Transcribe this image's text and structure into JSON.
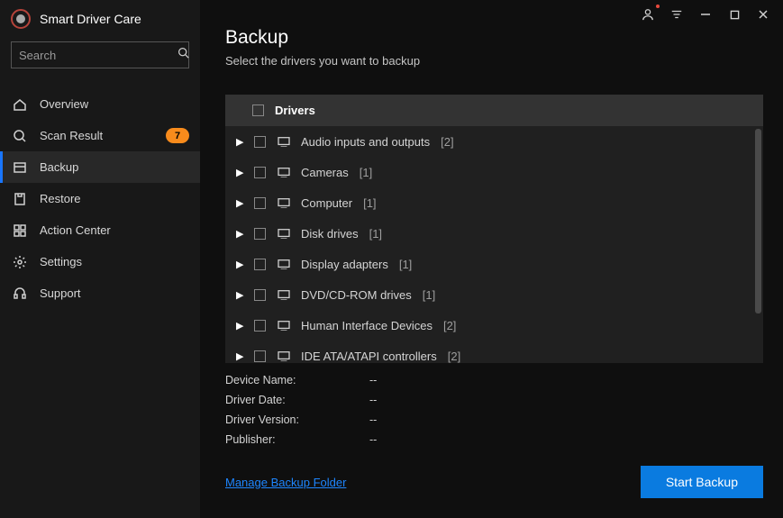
{
  "app": {
    "title": "Smart Driver Care"
  },
  "search": {
    "placeholder": "Search"
  },
  "sidebar": {
    "items": [
      {
        "label": "Overview",
        "badge": null
      },
      {
        "label": "Scan Result",
        "badge": "7"
      },
      {
        "label": "Backup",
        "badge": null
      },
      {
        "label": "Restore",
        "badge": null
      },
      {
        "label": "Action Center",
        "badge": null
      },
      {
        "label": "Settings",
        "badge": null
      },
      {
        "label": "Support",
        "badge": null
      }
    ]
  },
  "page": {
    "title": "Backup",
    "subtitle": "Select the drivers you want to backup",
    "driversHeader": "Drivers",
    "manageLink": "Manage Backup Folder",
    "startButton": "Start Backup"
  },
  "drivers": [
    {
      "name": "Audio inputs and outputs",
      "count": "[2]"
    },
    {
      "name": "Cameras",
      "count": "[1]"
    },
    {
      "name": "Computer",
      "count": "[1]"
    },
    {
      "name": "Disk drives",
      "count": "[1]"
    },
    {
      "name": "Display adapters",
      "count": "[1]"
    },
    {
      "name": "DVD/CD-ROM drives",
      "count": "[1]"
    },
    {
      "name": "Human Interface Devices",
      "count": "[2]"
    },
    {
      "name": "IDE ATA/ATAPI controllers",
      "count": "[2]"
    }
  ],
  "details": {
    "labels": {
      "deviceName": "Device Name:",
      "driverDate": "Driver Date:",
      "driverVersion": "Driver Version:",
      "publisher": "Publisher:"
    },
    "values": {
      "deviceName": "--",
      "driverDate": "--",
      "driverVersion": "--",
      "publisher": "--"
    }
  }
}
